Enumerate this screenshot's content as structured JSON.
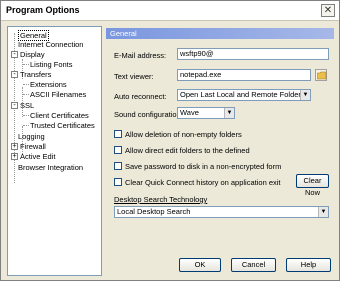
{
  "window": {
    "title": "Program Options",
    "close_glyph": "✕"
  },
  "tree": {
    "items": [
      {
        "label": "General"
      },
      {
        "label": "Internet Connection"
      },
      {
        "label": "Display"
      },
      {
        "label": "Listing Fonts"
      },
      {
        "label": "Transfers"
      },
      {
        "label": "Extensions"
      },
      {
        "label": "ASCII Filenames"
      },
      {
        "label": "SSL"
      },
      {
        "label": "Client Certificates"
      },
      {
        "label": "Trusted Certificates"
      },
      {
        "label": "Logging"
      },
      {
        "label": "Firewall"
      },
      {
        "label": "Active Edit"
      },
      {
        "label": "Browser Integration"
      }
    ]
  },
  "general": {
    "header": "General",
    "email_label": "E-Mail address:",
    "email_value": "wsftp90@",
    "editor_label": "Text viewer:",
    "editor_value": "notepad.exe",
    "autoreconnect_label": "Auto reconnect:",
    "autoreconnect_value": "Open Last Local and Remote Folders",
    "sound_label": "Sound configuration:",
    "sound_value": "Wave",
    "checks": [
      {
        "label": "Allow deletion of non-empty folders",
        "checked": false
      },
      {
        "label": "Allow direct edit folders to the defined",
        "checked": false
      },
      {
        "label": "Save password to disk in a non-encrypted form",
        "checked": false
      },
      {
        "label": "Clear Quick Connect history on application exit",
        "checked": false
      }
    ],
    "clear_now_label": "Clear Now",
    "desktop_search_label": "Desktop Search Technology",
    "desktop_search_value": "Local Desktop Search"
  },
  "buttons": {
    "ok": "OK",
    "cancel": "Cancel",
    "help": "Help"
  },
  "colors": {
    "header_start": "#7a96df",
    "header_end": "#a6b8e8",
    "dialog_bg": "#ece9d8"
  }
}
